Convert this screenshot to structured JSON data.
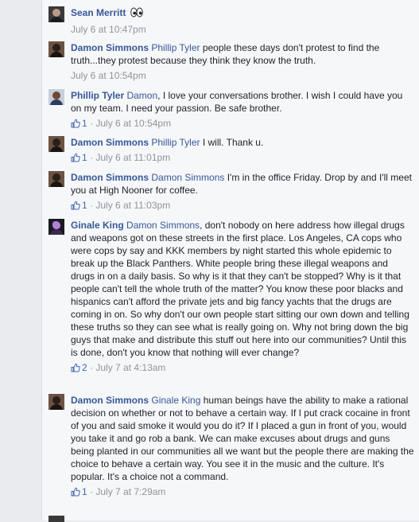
{
  "comments": [
    {
      "author": "Sean Merritt",
      "mention": "",
      "text": "",
      "has_eyes_emoji": true,
      "like_count": "",
      "time": "July 6 at 10:47pm"
    },
    {
      "author": "Damon Simmons",
      "mention": "Phillip Tyler",
      "text": " people these days don't protest to find the truth...they protest because they think they know the truth.",
      "like_count": "",
      "time": "July 6 at 10:54pm"
    },
    {
      "author": "Phillip Tyler",
      "mention": "Damon",
      "text": ", I love your conversations brother. I wish I could have you on my team. I need your passion. Be safe brother.",
      "like_count": "1",
      "time": "July 6 at 10:54pm"
    },
    {
      "author": "Damon Simmons",
      "mention": "Phillip Tyler",
      "text": " I will. Thank u.",
      "like_count": "1",
      "time": "July 6 at 11:01pm"
    },
    {
      "author": "Damon Simmons",
      "mention": "Damon Simmons",
      "text": " I'm in the office Friday. Drop by and I'll meet you at High Nooner for coffee.",
      "like_count": "1",
      "time": "July 6 at 11:03pm"
    },
    {
      "author": "Ginale King",
      "mention": "Damon Simmons",
      "text": ", don't nobody on here address how illegal drugs and weapons got on these streets in the first place. Los Angeles, CA cops who were cops by say and KKK members by night started this whole epidemic to break up the Black Panthers. White people bring these illegal weapons and drugs in on a daily basis. So why is it that they can't be stopped? Why is it that people can't tell the whole truth of the matter? You know these poor blacks and hispanics can't afford the private jets and big fancy yachts that the drugs are coming in on. So why don't our own people start sitting our own down and telling these truths so they can see what is really going on. Why not bring down the big guys that make and distribute this stuff out here into our communities? Until this is done, don't you know that nothing will ever change?",
      "like_count": "2",
      "time": "July 7 at 4:13am"
    },
    {
      "author": "Damon Simmons",
      "mention": "Ginale King",
      "text": " human beings have the ability to make a rational decision on whether or not to behave a certain way. If I put crack cocaine in front of you and said smoke it would you do it? If I placed a gun in front of you, would you take it and go rob a bank. We can make excuses about drugs and guns being planted in our communities all we want but the people there are making the choice to behave a certain way. You see it in the music and the culture. It's popular. It's a choice not a command.",
      "like_count": "1",
      "time": "July 7 at 7:29am"
    }
  ],
  "separator": " · ",
  "colors": {
    "link": "#365899",
    "meta": "#90949c",
    "like": "#4267b2",
    "background": "#f6f7f9"
  }
}
